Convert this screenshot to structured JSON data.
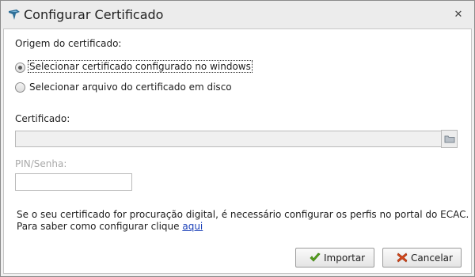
{
  "window": {
    "title": "Configurar Certificado",
    "app_icon": "pin-icon",
    "close_glyph": "✕"
  },
  "origin": {
    "label": "Origem do certificado:",
    "options": [
      {
        "label": "Selecionar certificado configurado no windows",
        "selected": true
      },
      {
        "label": "Selecionar arquivo do certificado em disco",
        "selected": false
      }
    ]
  },
  "certificate": {
    "label": "Certificado:",
    "value": "",
    "browse_icon": "folder-icon"
  },
  "pin": {
    "label": "PIN/Senha:",
    "value": "",
    "disabled": true
  },
  "info": {
    "line1": "Se o seu certificado for procuração digital, é necessário configurar os perfis no portal do ECAC.",
    "line2_prefix": "Para saber como configurar clique ",
    "link_text": "aqui"
  },
  "buttons": {
    "import": {
      "label": "Importar",
      "icon": "checkmark-icon"
    },
    "cancel": {
      "label": "Cancelar",
      "icon": "x-icon"
    }
  },
  "colors": {
    "link": "#1a3fb8",
    "check": "#5aa61e",
    "cancel_x": "#d6471a",
    "disabled_text": "#a9a9a9"
  }
}
